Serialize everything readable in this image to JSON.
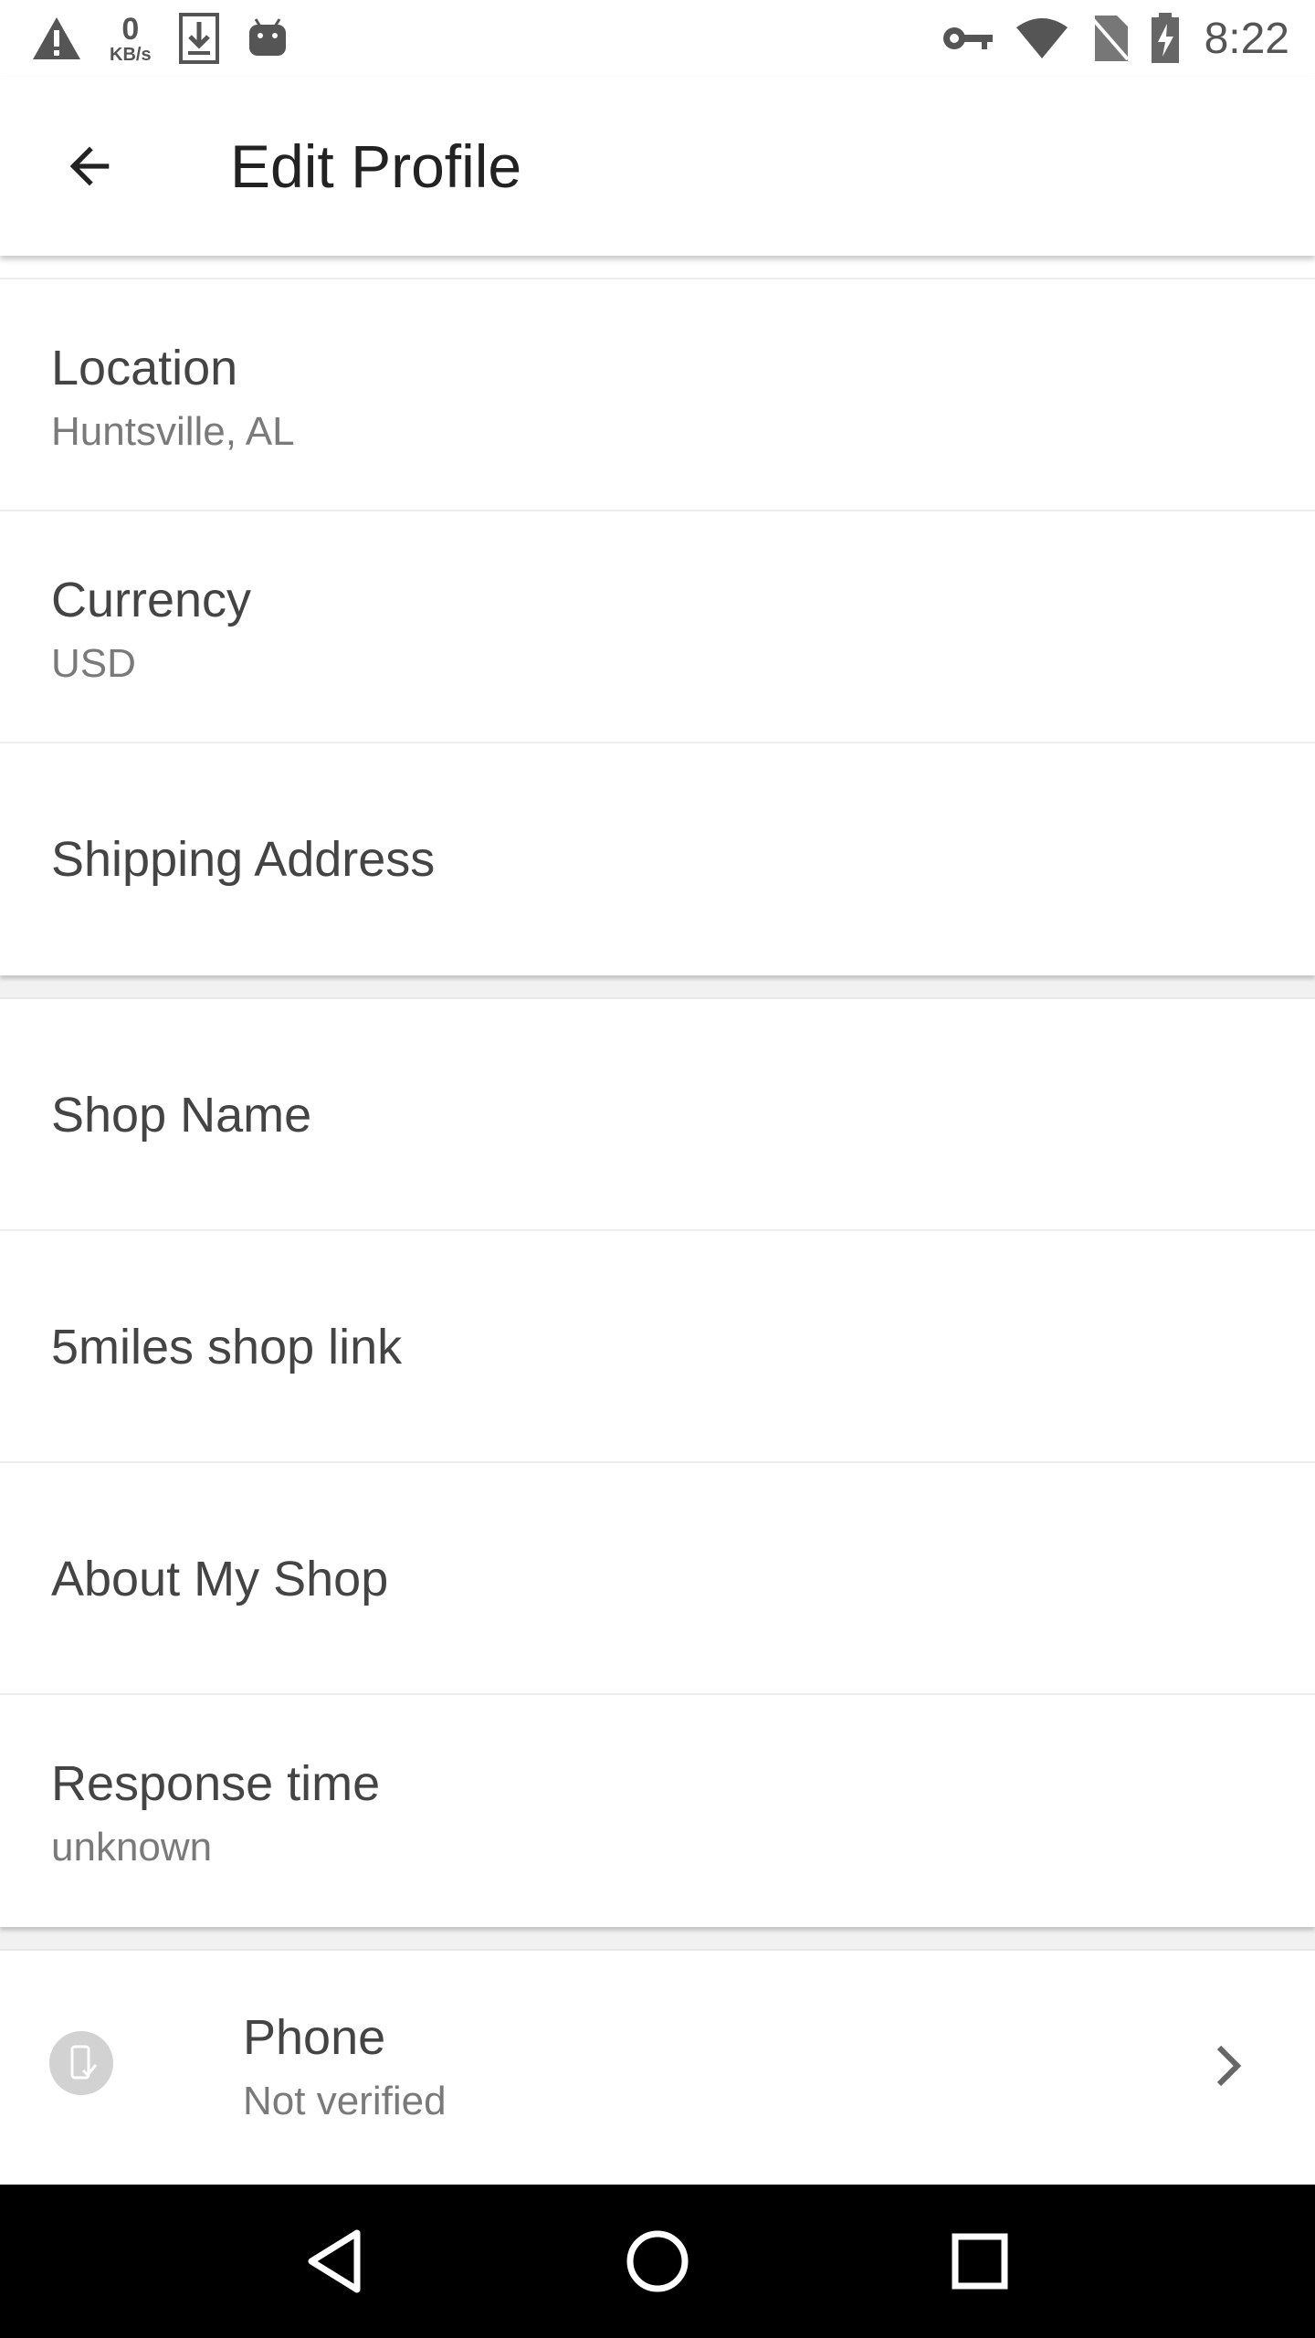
{
  "status_bar": {
    "net_speed_value": "0",
    "net_speed_unit": "KB/s",
    "time": "8:22"
  },
  "app_bar": {
    "title": "Edit Profile"
  },
  "profile_items": [
    {
      "title": "Location",
      "value": "Huntsville, AL"
    },
    {
      "title": "Currency",
      "value": "USD"
    },
    {
      "title": "Shipping Address",
      "value": ""
    }
  ],
  "shop_items": [
    {
      "title": "Shop Name",
      "value": ""
    },
    {
      "title": "5miles shop link",
      "value": ""
    },
    {
      "title": "About My Shop",
      "value": ""
    },
    {
      "title": "Response time",
      "value": "unknown"
    }
  ],
  "verification": {
    "phone_title": "Phone",
    "phone_status": "Not verified"
  },
  "icons": {
    "back": "arrow-left-icon",
    "phone": "phone-verify-icon",
    "chevron": "chevron-right-icon"
  },
  "colors": {
    "background": "#ffffff",
    "divider": "#eeeeee",
    "nav_bar": "#000000"
  }
}
